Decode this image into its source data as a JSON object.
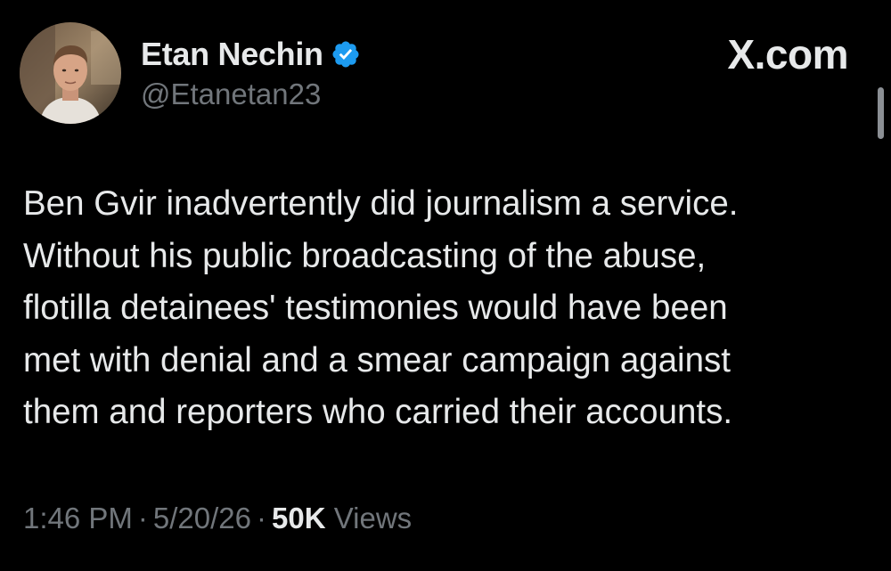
{
  "author": {
    "display_name": "Etan Nechin",
    "handle": "@Etanetan23",
    "verified_icon": "verified-badge-icon",
    "avatar_icon": "user-avatar"
  },
  "brand": {
    "label": "X.com"
  },
  "tweet": {
    "lines": [
      "Ben Gvir inadvertently did journalism a service.",
      "Without his public broadcasting of the abuse,",
      "flotilla detainees' testimonies would have been",
      "met with denial and a smear campaign against",
      "them and reporters who carried their accounts."
    ]
  },
  "meta": {
    "time": "1:46 PM",
    "separator": "·",
    "date": "5/20/26",
    "views_count": "50K",
    "views_label": "Views"
  },
  "colors": {
    "background": "#000000",
    "primary_text": "#e7e9ea",
    "secondary_text": "#71767b",
    "verified_blue": "#1d9bf0"
  }
}
